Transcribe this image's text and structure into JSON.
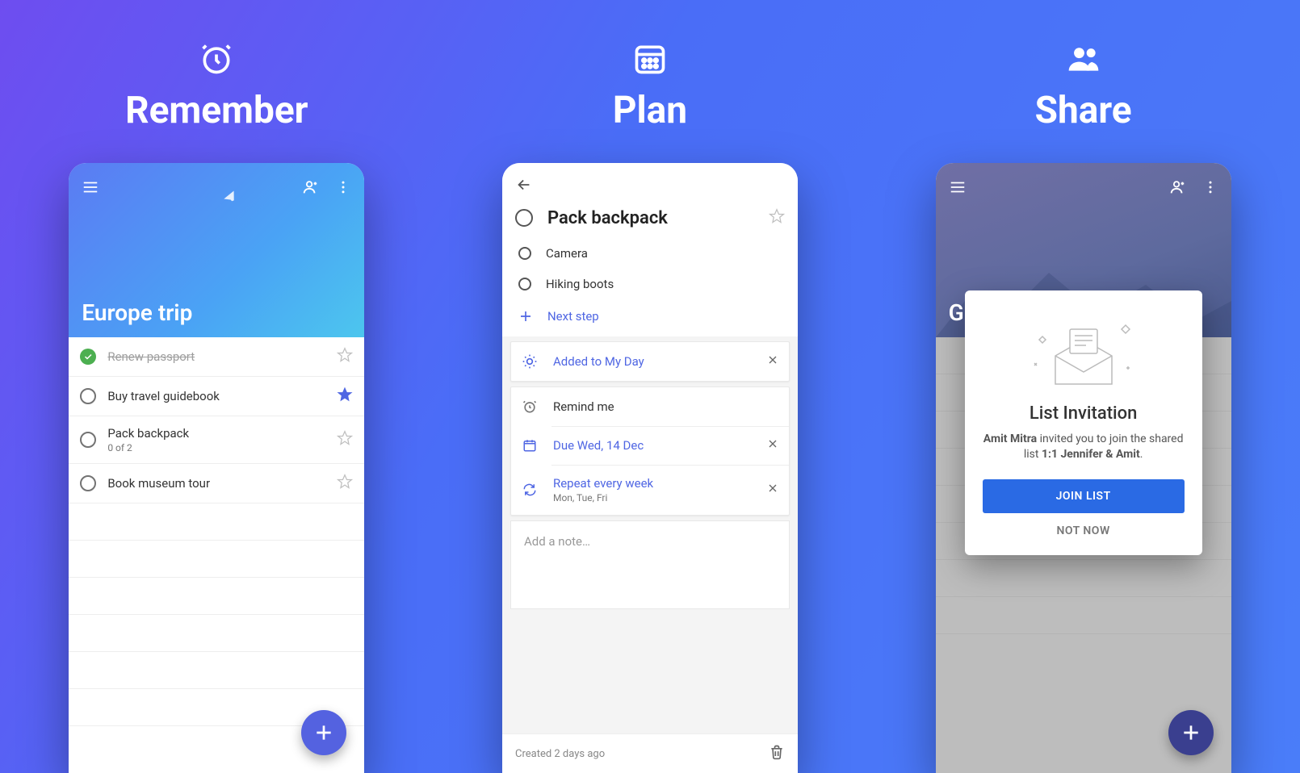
{
  "sections": {
    "remember": "Remember",
    "plan": "Plan",
    "share": "Share"
  },
  "phone1": {
    "list_title": "Europe trip",
    "tasks": [
      {
        "label": "Renew passport",
        "completed": true,
        "starred": false,
        "sub": ""
      },
      {
        "label": "Buy travel guidebook",
        "completed": false,
        "starred": true,
        "sub": ""
      },
      {
        "label": "Pack backpack",
        "completed": false,
        "starred": false,
        "sub": "0 of 2"
      },
      {
        "label": "Book museum tour",
        "completed": false,
        "starred": false,
        "sub": ""
      }
    ]
  },
  "phone2": {
    "task_title": "Pack backpack",
    "subtasks": [
      "Camera",
      "Hiking boots"
    ],
    "next_step": "Next step",
    "myday": "Added to My Day",
    "remind": "Remind me",
    "due": "Due Wed, 14 Dec",
    "repeat": "Repeat every week",
    "repeat_sub": "Mon, Tue, Fri",
    "note_placeholder": "Add a note…",
    "created": "Created 2 days ago"
  },
  "phone3": {
    "list_title_partial": "G",
    "modal_title": "List Invitation",
    "inviter": "Amit Mitra",
    "invite_mid": " invited you to join the shared list ",
    "list_name": "1:1 Jennifer & Amit",
    "join": "JOIN LIST",
    "not_now": "NOT NOW"
  }
}
